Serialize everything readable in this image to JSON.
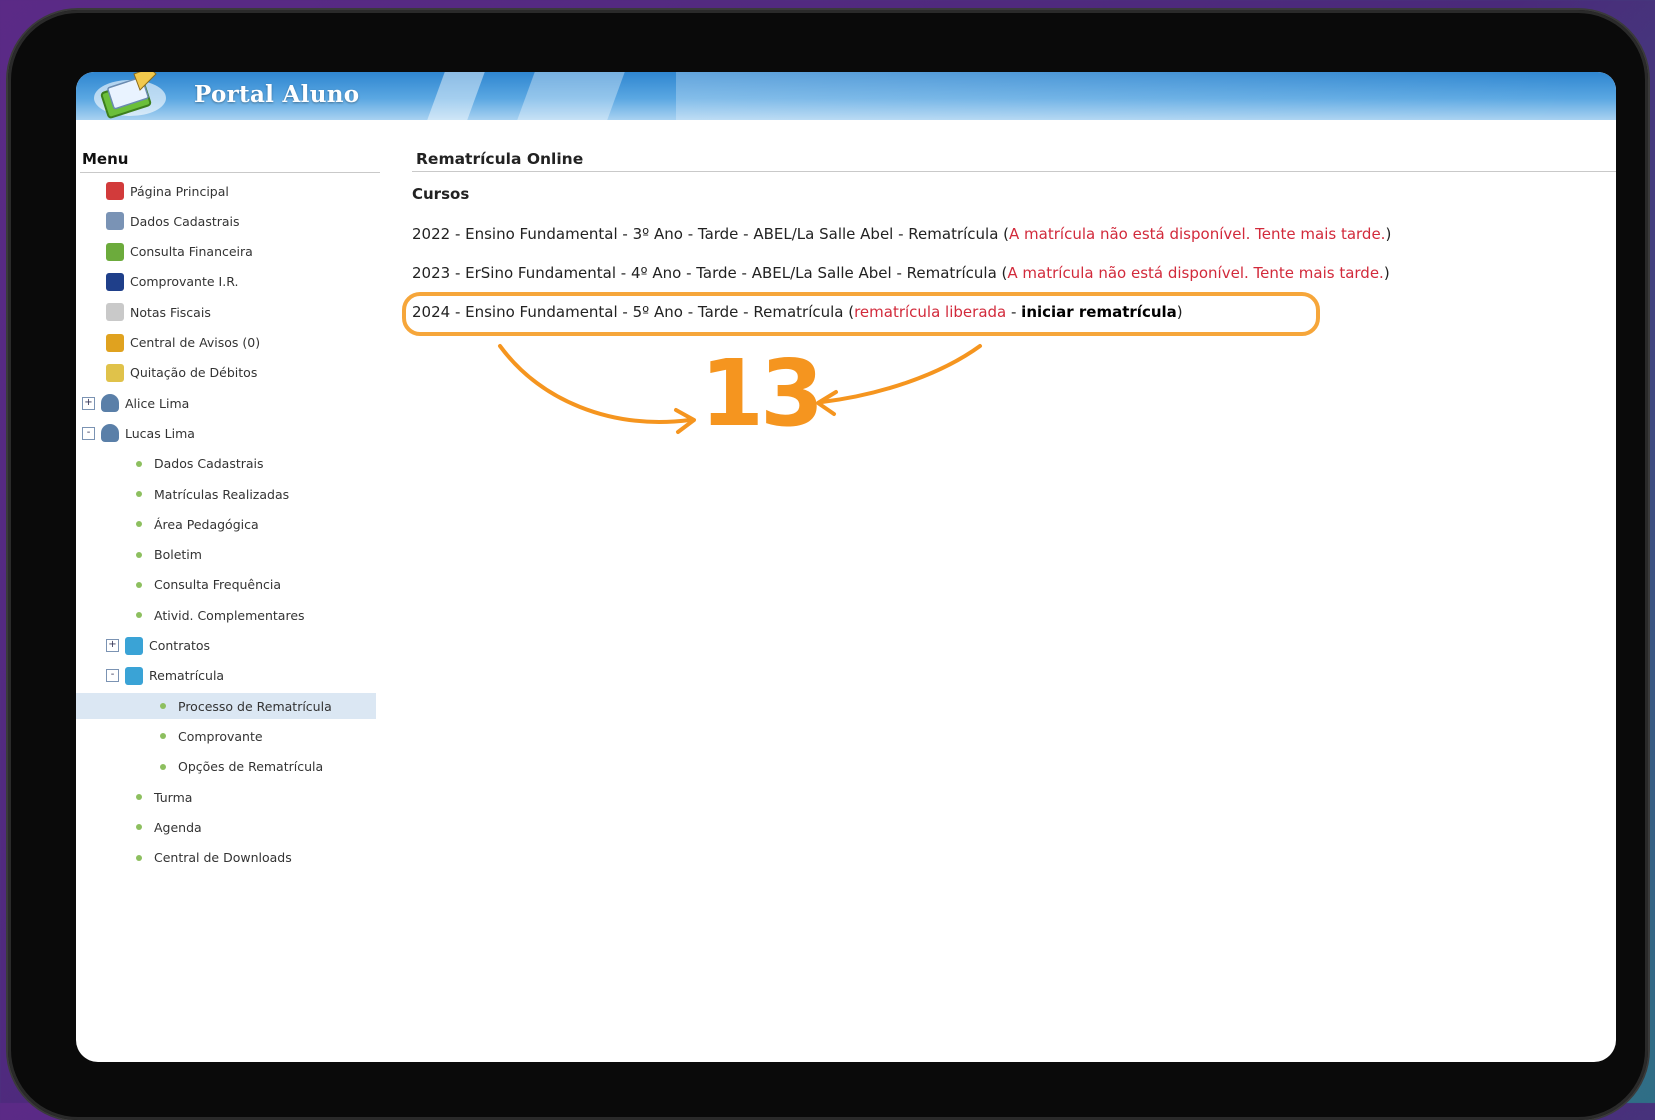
{
  "banner": {
    "title": "Portal Aluno"
  },
  "menu": {
    "title": "Menu",
    "items": [
      {
        "label": "Página Principal",
        "icon": "home-icon",
        "indent": 0
      },
      {
        "label": "Dados Cadastrais",
        "icon": "id-card-icon",
        "indent": 0
      },
      {
        "label": "Consulta Financeira",
        "icon": "money-icon",
        "indent": 0
      },
      {
        "label": "Comprovante I.R.",
        "icon": "tax-receipt-icon",
        "indent": 0
      },
      {
        "label": "Notas Fiscais",
        "icon": "invoice-icon",
        "indent": 0
      },
      {
        "label": "Central de Avisos (0)",
        "icon": "notice-icon",
        "indent": 0
      },
      {
        "label": "Quitação de Débitos",
        "icon": "payment-icon",
        "indent": 0
      },
      {
        "label": "Alice Lima",
        "icon": "user-icon",
        "indent": 0,
        "expander": "+"
      },
      {
        "label": "Lucas Lima",
        "icon": "user-icon",
        "indent": 0,
        "expander": "-"
      },
      {
        "label": "Dados Cadastrais",
        "indent": 1
      },
      {
        "label": "Matrículas Realizadas",
        "indent": 1
      },
      {
        "label": "Área Pedagógica",
        "indent": 1
      },
      {
        "label": "Boletim",
        "indent": 1
      },
      {
        "label": "Consulta Frequência",
        "indent": 1
      },
      {
        "label": "Ativid. Complementares",
        "indent": 1
      },
      {
        "label": "Contratos",
        "icon": "folder-icon",
        "indent": 1,
        "expander": "+"
      },
      {
        "label": "Rematrícula",
        "icon": "folder-icon",
        "indent": 1,
        "expander": "-"
      },
      {
        "label": "Processo de Rematrícula",
        "indent": 2,
        "active": true
      },
      {
        "label": "Comprovante",
        "indent": 2
      },
      {
        "label": "Opções de Rematrícula",
        "indent": 2
      },
      {
        "label": "Turma",
        "indent": 1
      },
      {
        "label": "Agenda",
        "indent": 1
      },
      {
        "label": "Central de Downloads",
        "indent": 1
      }
    ]
  },
  "main": {
    "title": "Rematrícula Online",
    "section": "Cursos",
    "courses": [
      {
        "text": "2022 - Ensino Fundamental - 3º Ano - Tarde - ABEL/La Salle Abel - Rematrícula (",
        "status": "A matrícula não está disponível. Tente mais tarde.",
        "close": ")"
      },
      {
        "text": "2023 - ErSino Fundamental - 4º Ano - Tarde - ABEL/La Salle Abel - Rematrícula (",
        "status": "A matrícula não está disponível. Tente mais tarde.",
        "close": ")"
      },
      {
        "text": "2024 - Ensino Fundamental - 5º Ano - Tarde - Rematrícula (",
        "status": "rematrícula liberada",
        "sep": " - ",
        "action": "iniciar rematrícula",
        "close": ")"
      }
    ]
  },
  "annotation": {
    "step": "13",
    "color": "#f5951f"
  }
}
